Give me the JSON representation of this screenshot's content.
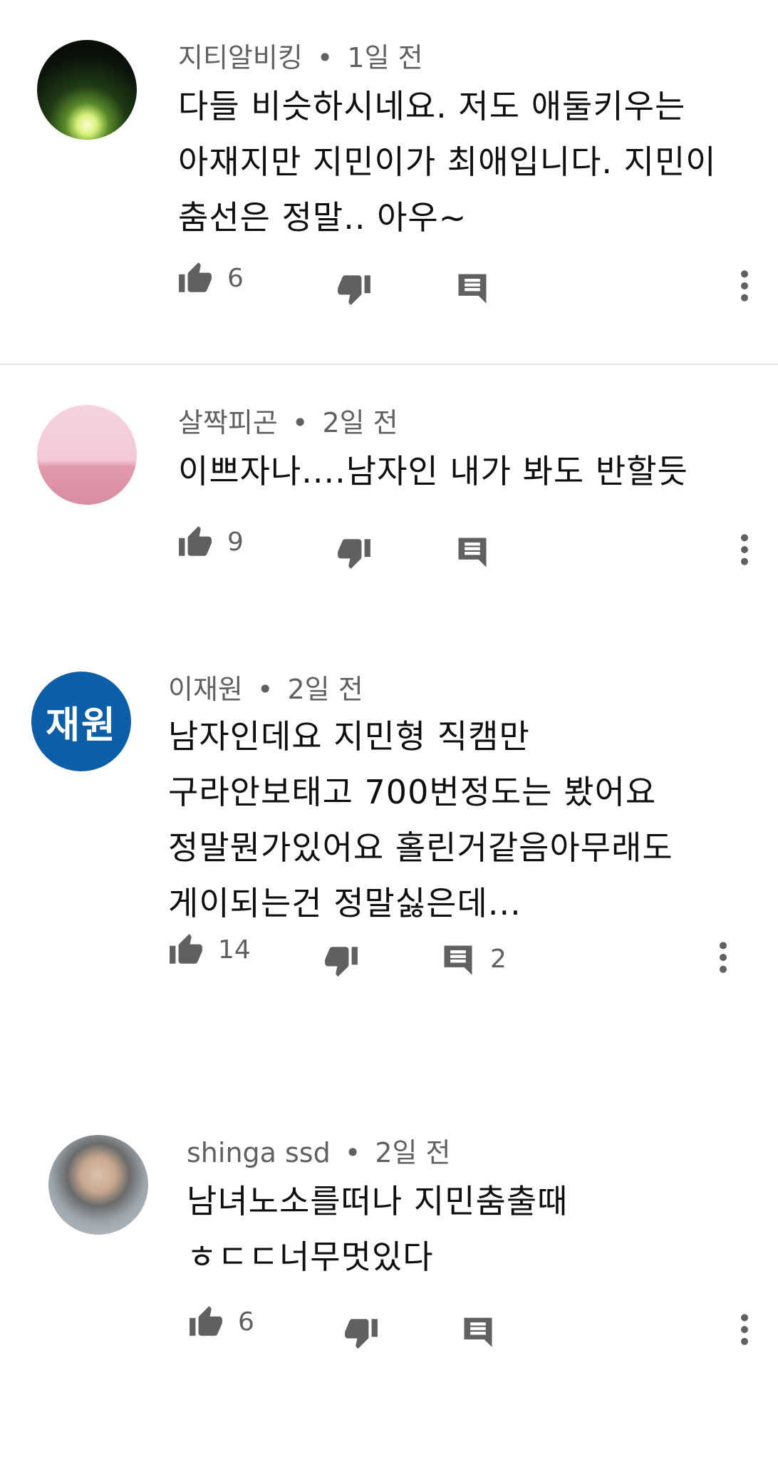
{
  "comments": [
    {
      "author": "지티알비킹",
      "time": "1일 전",
      "text": "다들 비슷하시네요. 저도 애둘키우는\n아재지만 지민이가 최애입니다. 지민이\n춤선은 정말.. 아우~",
      "likes": "6",
      "replies": ""
    },
    {
      "author": "살짝피곤",
      "time": "2일 전",
      "text": "이쁘자나....남자인 내가 봐도 반할듯",
      "likes": "9",
      "replies": ""
    },
    {
      "author": "이재원",
      "avatar_text": "재원",
      "time": "2일 전",
      "text": "남자인데요 지민형 직캠만\n구라안보태고 700번정도는 봤어요\n정말뭔가있어요 홀린거같음아무래도\n게이되는건 정말싫은데...",
      "likes": "14",
      "replies": "2"
    },
    {
      "author": "shinga ssd",
      "time": "2일 전",
      "text": "남녀노소를떠나 지민춤출때\nㅎㄷㄷ너무멋있다",
      "likes": "6",
      "replies": ""
    }
  ],
  "meta_separator": "•",
  "icons": {
    "like": "thumbs-up-icon",
    "dislike": "thumbs-down-icon",
    "reply": "comment-icon",
    "more": "more-vertical-icon"
  },
  "colors": {
    "text": "#0f0f0f",
    "meta": "#606060",
    "icon": "#606060",
    "divider": "#e6e6e6",
    "avatar_blue": "#0d5ea8"
  }
}
